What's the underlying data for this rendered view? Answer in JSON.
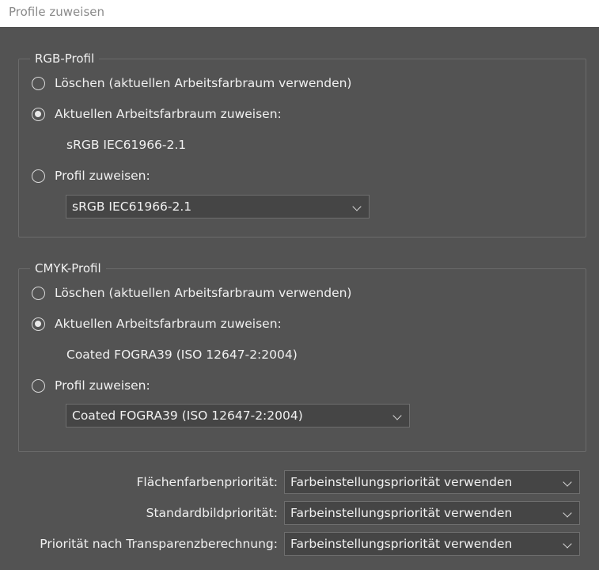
{
  "window": {
    "title": "Profile zuweisen"
  },
  "rgb": {
    "legend": "RGB-Profil",
    "option_delete": "Löschen (aktuellen Arbeitsfarbraum verwenden)",
    "option_assign_working": "Aktuellen Arbeitsfarbraum zuweisen:",
    "working_profile": "sRGB IEC61966-2.1",
    "option_assign_profile": "Profil zuweisen:",
    "profile_select_value": "sRGB IEC61966-2.1",
    "selected": "assign_working"
  },
  "cmyk": {
    "legend": "CMYK-Profil",
    "option_delete": "Löschen (aktuellen Arbeitsfarbraum verwenden)",
    "option_assign_working": "Aktuellen Arbeitsfarbraum zuweisen:",
    "working_profile": "Coated FOGRA39 (ISO 12647-2:2004)",
    "option_assign_profile": "Profil zuweisen:",
    "profile_select_value": "Coated FOGRA39 (ISO 12647-2:2004)",
    "selected": "assign_working"
  },
  "priorities": [
    {
      "label": "Flächenfarbenpriorität:",
      "value": "Farbeinstellungspriorität verwenden"
    },
    {
      "label": "Standardbildpriorität:",
      "value": "Farbeinstellungspriorität verwenden"
    },
    {
      "label": "Priorität nach Transparenzberechnung:",
      "value": "Farbeinstellungspriorität verwenden"
    }
  ],
  "colors": {
    "background": "#535353",
    "field": "#454545",
    "text": "#f0f0f0"
  }
}
